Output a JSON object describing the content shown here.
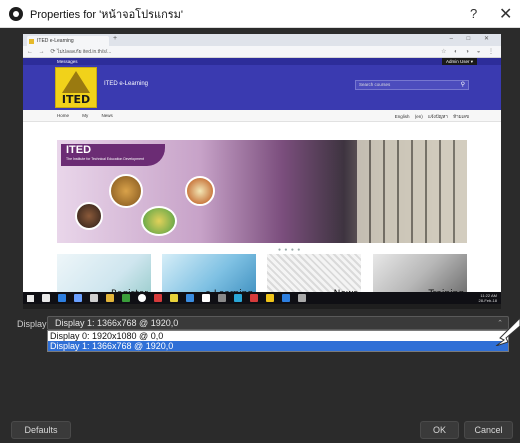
{
  "window": {
    "title": "Properties for 'หน้าจอโปรแกรม'",
    "help": "?",
    "close": "✕"
  },
  "browser": {
    "tab_title": "ITED e-Learning",
    "new_tab": "+",
    "window_controls": "– □ ✕",
    "nav_glyphs": "← → ⟳",
    "url": "ไม่ปลอดภัย  ited.in.th/s/...",
    "ext_glyphs": "☆ ◐ ◑ ◒ ⋮"
  },
  "site": {
    "messages": "Messages",
    "user_menu": "Admin User ▾",
    "logo_text": "ITED",
    "name": "ITED e-Learning",
    "search_placeholder": "Search courses",
    "nav_left": "Home My News",
    "nav_right": "English (en) แจ้งปัญหา ห้ามเลข",
    "banner_title": "ITED",
    "banner_subtitle": "The Institute for Technical Education Development",
    "carousel_dots": "● ● ● ●",
    "tiles": [
      "Register",
      "e-Learning",
      "News",
      "Training"
    ]
  },
  "taskbar": {
    "time": "11:22 AM",
    "date": "28-Feb-18",
    "app_colors": [
      "#e8e8e8",
      "#2d7fe0",
      "#6aa0ff",
      "#cfcfcf",
      "#e2b53a",
      "#3a9e3a",
      "#ffffff",
      "#d63b3b",
      "#e8d23a",
      "#3a8de0",
      "#ffffff",
      "#8a8a8a",
      "#2aa6d6",
      "#d63b3b",
      "#f0c419",
      "#2d7fe0",
      "#aaaaaa"
    ]
  },
  "display": {
    "label": "Display",
    "selected": "Display 1: 1366x768 @ 1920,0",
    "options": [
      "Display 0: 1920x1080 @ 0,0",
      "Display 1: 1366x768 @ 1920,0"
    ]
  },
  "buttons": {
    "defaults": "Defaults",
    "ok": "OK",
    "cancel": "Cancel"
  }
}
